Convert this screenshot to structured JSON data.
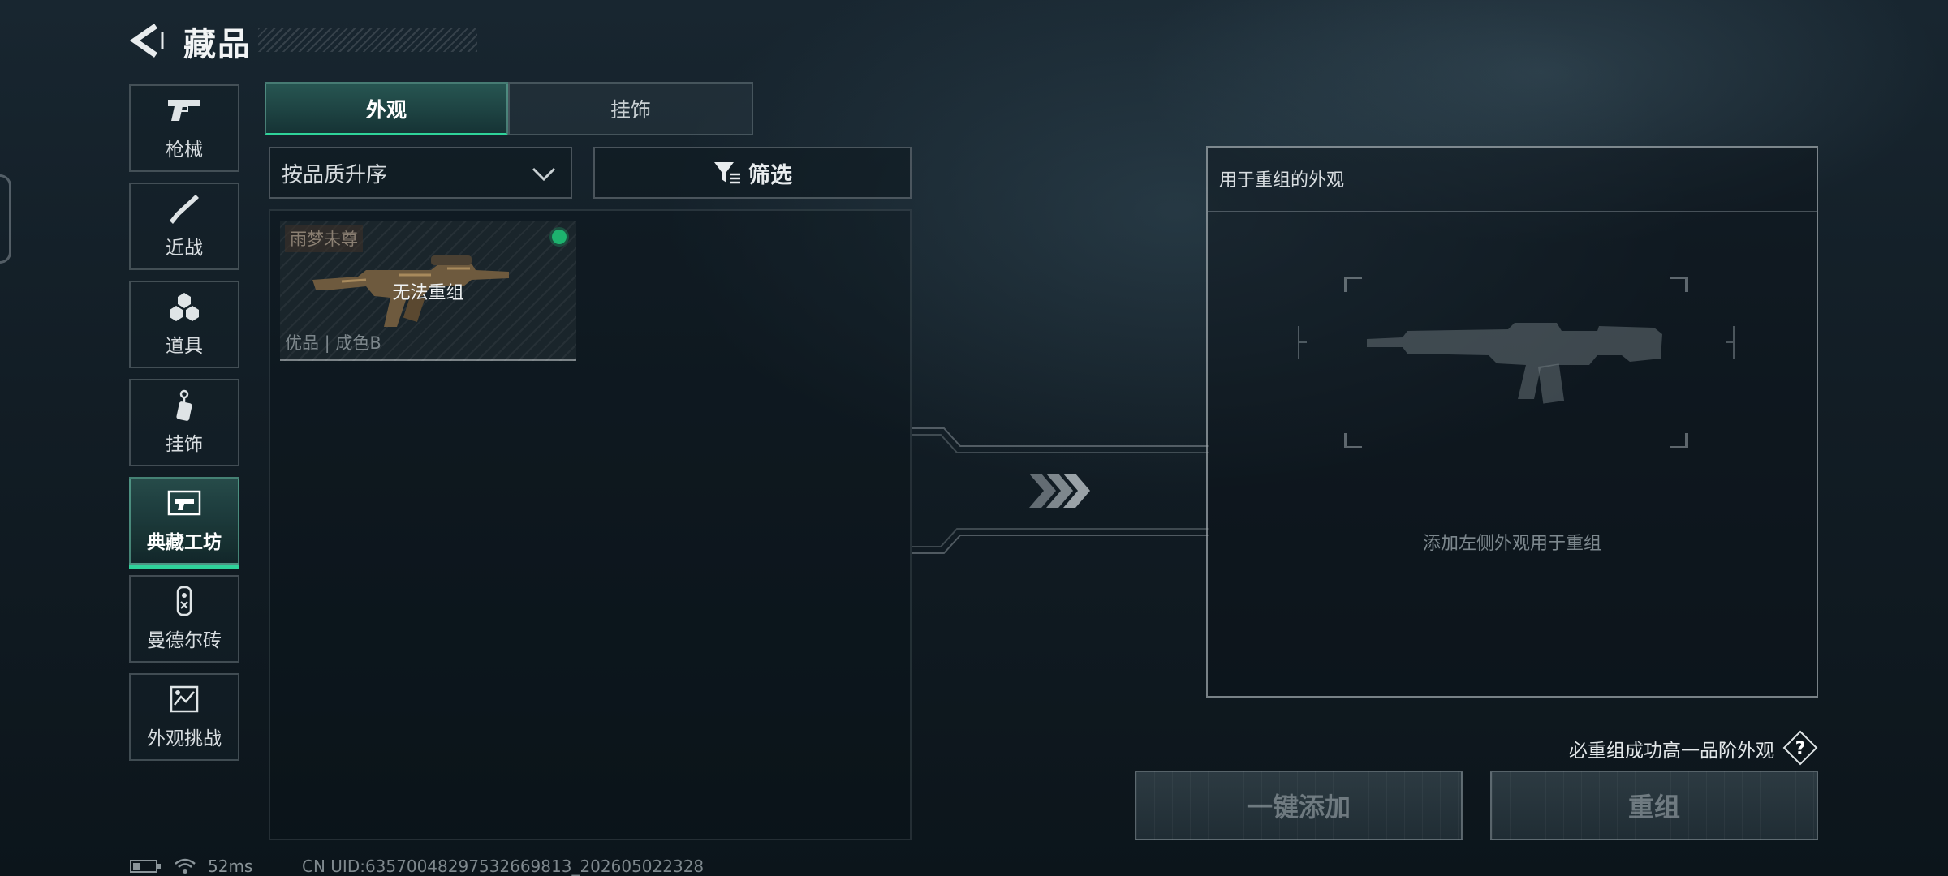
{
  "header": {
    "title": "藏品"
  },
  "sidebar": {
    "items": [
      {
        "label": "枪械",
        "icon": "pistol-icon",
        "active": false
      },
      {
        "label": "近战",
        "icon": "knife-icon",
        "active": false
      },
      {
        "label": "道具",
        "icon": "grenade-icon",
        "active": false
      },
      {
        "label": "挂饰",
        "icon": "pendant-icon",
        "active": false
      },
      {
        "label": "典藏工坊",
        "icon": "workshop-icon",
        "active": true
      },
      {
        "label": "曼德尔砖",
        "icon": "brick-icon",
        "active": false
      },
      {
        "label": "外观挑战",
        "icon": "challenge-icon",
        "active": false
      }
    ]
  },
  "tabs": [
    {
      "label": "外观",
      "active": true
    },
    {
      "label": "挂饰",
      "active": false
    }
  ],
  "sort": {
    "value": "按品质升序"
  },
  "filter": {
    "label": "筛选"
  },
  "items": [
    {
      "name": "雨梦未尊",
      "status": "无法重组",
      "grade": "优品 | 成色B",
      "equipped": true
    }
  ],
  "recombine": {
    "title": "用于重组的外观",
    "hint": "添加左侧外观用于重组"
  },
  "footer": {
    "guarantee": "必重组成功高一品阶外观",
    "help": "?",
    "add_all": "一键添加",
    "recombine": "重组"
  },
  "status_bar": {
    "ping": "52ms",
    "uid": "CN UID:6357004829753266981​3_202605022328"
  },
  "colors": {
    "accent": "#2fd39a",
    "equipped_dot": "#1db36e",
    "background": "#121d25"
  }
}
